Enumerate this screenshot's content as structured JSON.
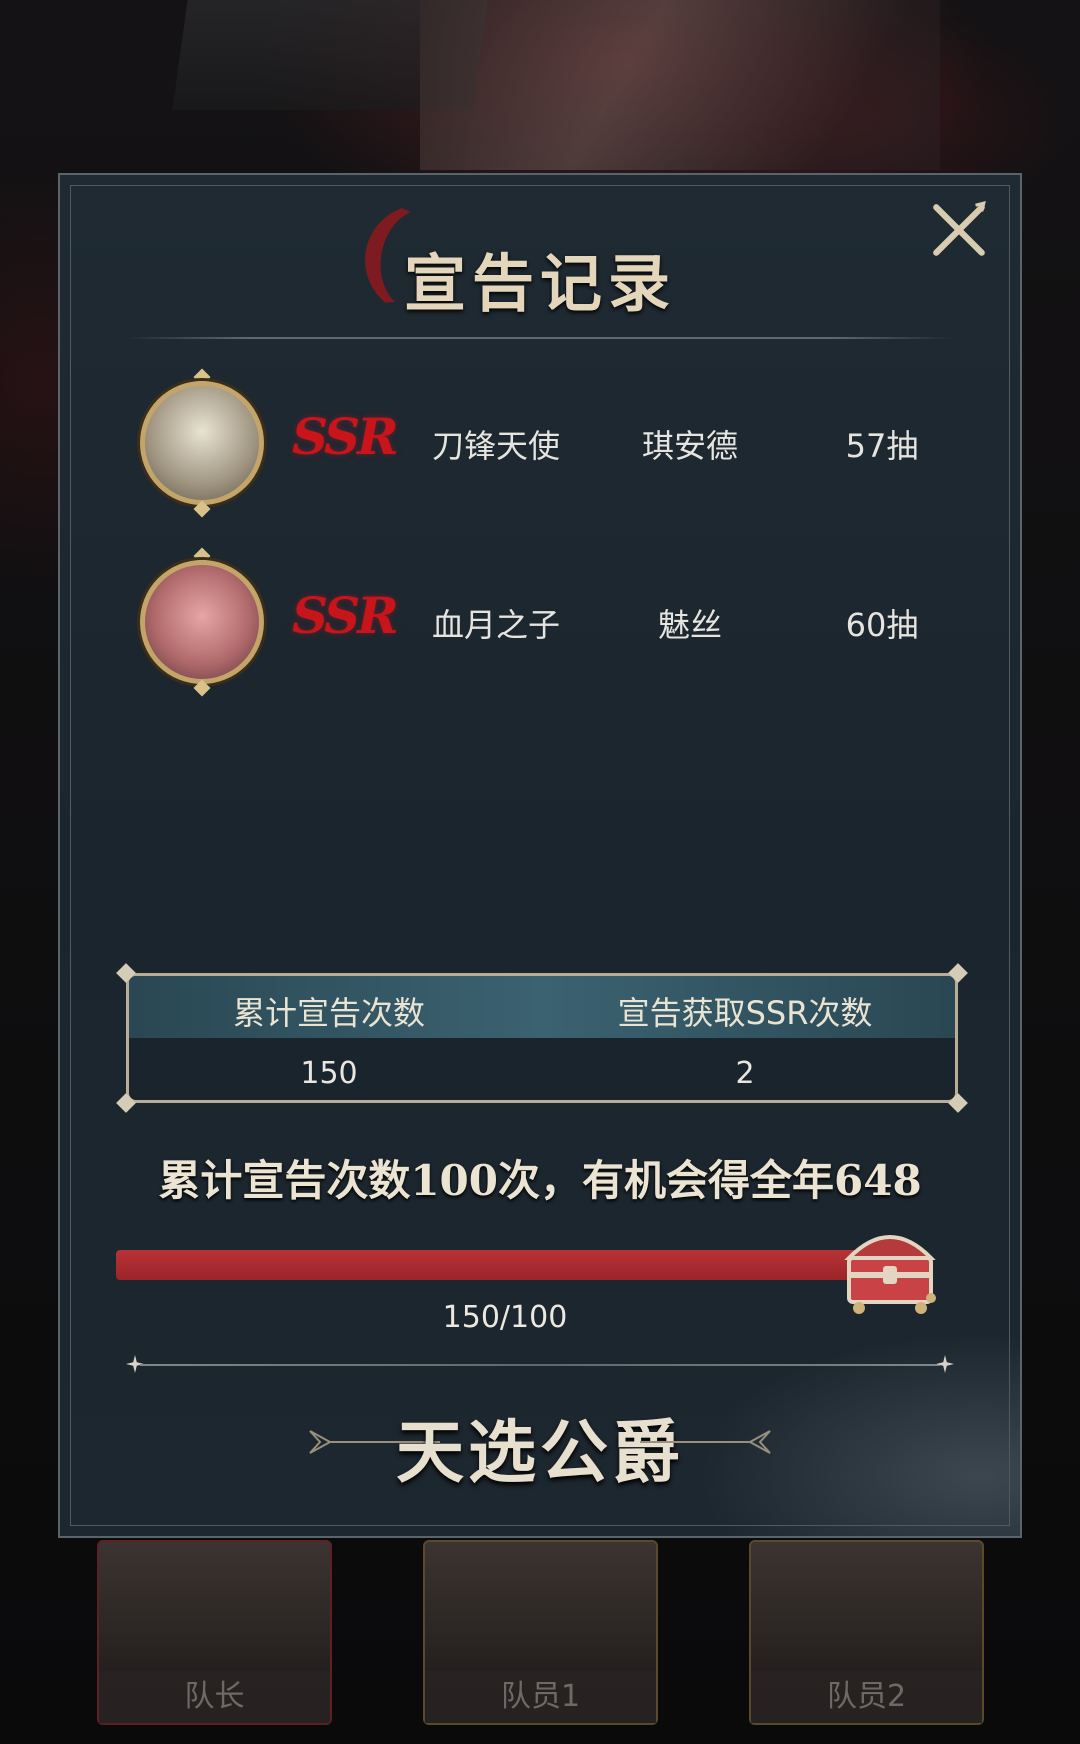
{
  "dialog": {
    "title": "宣告记录",
    "close_icon": "close-icon"
  },
  "records": [
    {
      "rarity": "SSR",
      "title": "刀锋天使",
      "name": "琪安德",
      "pulls": "57抽"
    },
    {
      "rarity": "SSR",
      "title": "血月之子",
      "name": "魅丝",
      "pulls": "60抽"
    }
  ],
  "stats": {
    "total_label": "累计宣告次数",
    "ssr_label": "宣告获取SSR次数",
    "total_value": "150",
    "ssr_value": "2"
  },
  "promo": "累计宣告次数100次，有机会得全年648",
  "progress": {
    "text": "150/100",
    "fill_fraction": 1.0
  },
  "footer_title": "天选公爵",
  "team": {
    "slot1": "队长",
    "slot2": "队员1",
    "slot3": "队员2"
  },
  "colors": {
    "ssr_red": "#c8141b",
    "progress_red": "#b83236",
    "gold": "#c3a56a"
  }
}
